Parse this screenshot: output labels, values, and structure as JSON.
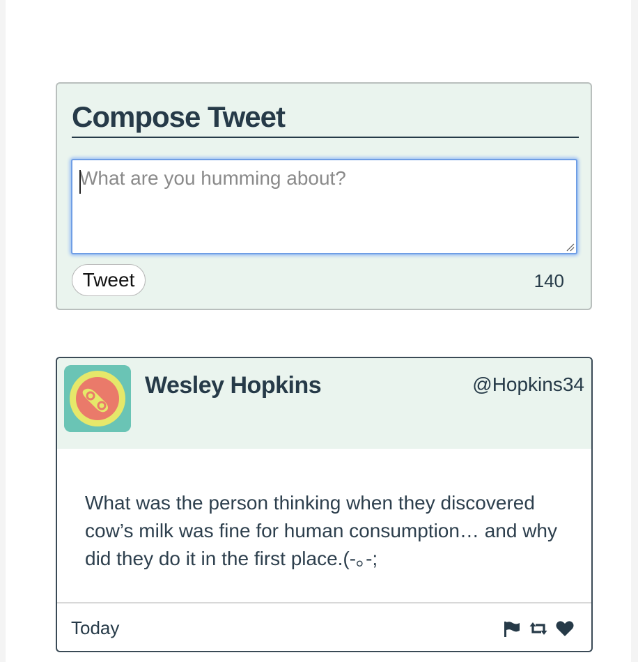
{
  "compose": {
    "title": "Compose Tweet",
    "placeholder": "What are you humming about?",
    "button_label": "Tweet",
    "char_counter": "140"
  },
  "tweet": {
    "user_name": "Wesley Hopkins",
    "handle": "@Hopkins34",
    "text": "What was the person thinking when they discovered cow’s milk was fine for human consumption… and why did they do it in the first place.(-｡-;",
    "date": "Today",
    "actions": [
      "flag-icon",
      "retweet-icon",
      "heart-icon"
    ]
  },
  "colors": {
    "header_bg": "#eaf4ee",
    "text_dark": "#263a48",
    "focus_ring": "#6f9ee5",
    "avatar_bg": "#6ac4b5"
  }
}
